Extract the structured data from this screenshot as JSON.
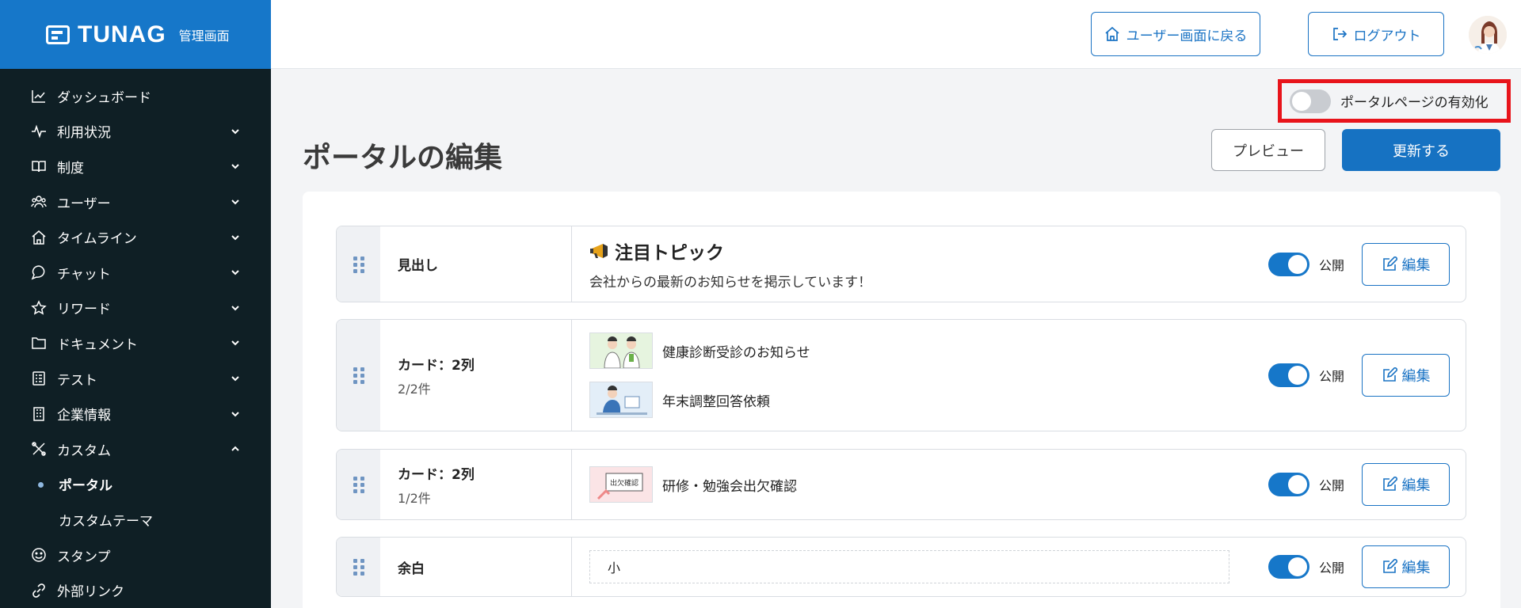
{
  "sidebar": {
    "logo": "TUNAG",
    "logo_sub": "管理画面",
    "items": [
      {
        "label": "ダッシュボード"
      },
      {
        "label": "利用状況"
      },
      {
        "label": "制度"
      },
      {
        "label": "ユーザー"
      },
      {
        "label": "タイムライン"
      },
      {
        "label": "チャット"
      },
      {
        "label": "リワード"
      },
      {
        "label": "ドキュメント"
      },
      {
        "label": "テスト"
      },
      {
        "label": "企業情報"
      },
      {
        "label": "カスタム"
      },
      {
        "label": "スタンプ"
      },
      {
        "label": "外部リンク"
      }
    ],
    "sub_items": [
      {
        "label": "ポータル"
      },
      {
        "label": "カスタムテーマ"
      }
    ]
  },
  "header": {
    "back_label": "ユーザー画面に戻る",
    "logout_label": "ログアウト"
  },
  "main": {
    "enable_label": "ポータルページの有効化",
    "title": "ポータルの編集",
    "preview_label": "プレビュー",
    "update_label": "更新する",
    "public_label": "公開",
    "edit_label": "編集",
    "rows": [
      {
        "type": "見出し",
        "title": "注目トピック",
        "subtitle": "会社からの最新のお知らせを掲示しています！"
      },
      {
        "type": "カード：2列",
        "count": "2/2件",
        "items": [
          "健康診断受診のお知らせ",
          "年末調整回答依頼"
        ]
      },
      {
        "type": "カード：2列",
        "count": "1/2件",
        "items": [
          "研修・勉強会出欠確認"
        ],
        "thumb_text": "出欠確認"
      },
      {
        "type": "余白",
        "value": "小"
      }
    ]
  },
  "colors": {
    "accent": "#1677c9",
    "sidebar_bg": "#0f1f25",
    "highlight": "#e8141b"
  }
}
